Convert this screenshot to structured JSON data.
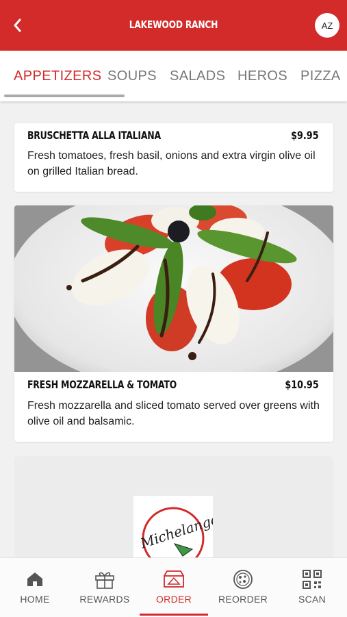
{
  "header": {
    "title": "LAKEWOOD RANCH",
    "avatar_initials": "AZ",
    "back_icon": "chevron-left-icon",
    "color": "#d32a2a"
  },
  "tabs": [
    {
      "label": "APPETIZERS",
      "active": true
    },
    {
      "label": "SOUPS"
    },
    {
      "label": "SALADS"
    },
    {
      "label": "HEROS"
    },
    {
      "label": "PIZZA"
    }
  ],
  "menu_items": [
    {
      "name": "BRUSCHETTA ALLA ITALIANA",
      "price": "$9.95",
      "description": "Fresh tomatoes, fresh basil, onions and extra virgin olive oil on grilled Italian bread."
    },
    {
      "name": "FRESH MOZZARELLA & TOMATO",
      "price": "$10.95",
      "description": "Fresh mozzarella and sliced tomato served over greens with olive oil and balsamic."
    }
  ],
  "logo": {
    "text": "Michelangelo"
  },
  "bottom_nav": [
    {
      "label": "HOME",
      "icon": "home-icon"
    },
    {
      "label": "REWARDS",
      "icon": "gift-icon"
    },
    {
      "label": "ORDER",
      "icon": "pizza-box-icon",
      "active": true
    },
    {
      "label": "REORDER",
      "icon": "pizza-icon"
    },
    {
      "label": "SCAN",
      "icon": "qr-code-icon"
    }
  ],
  "accent_color": "#d32a2a"
}
